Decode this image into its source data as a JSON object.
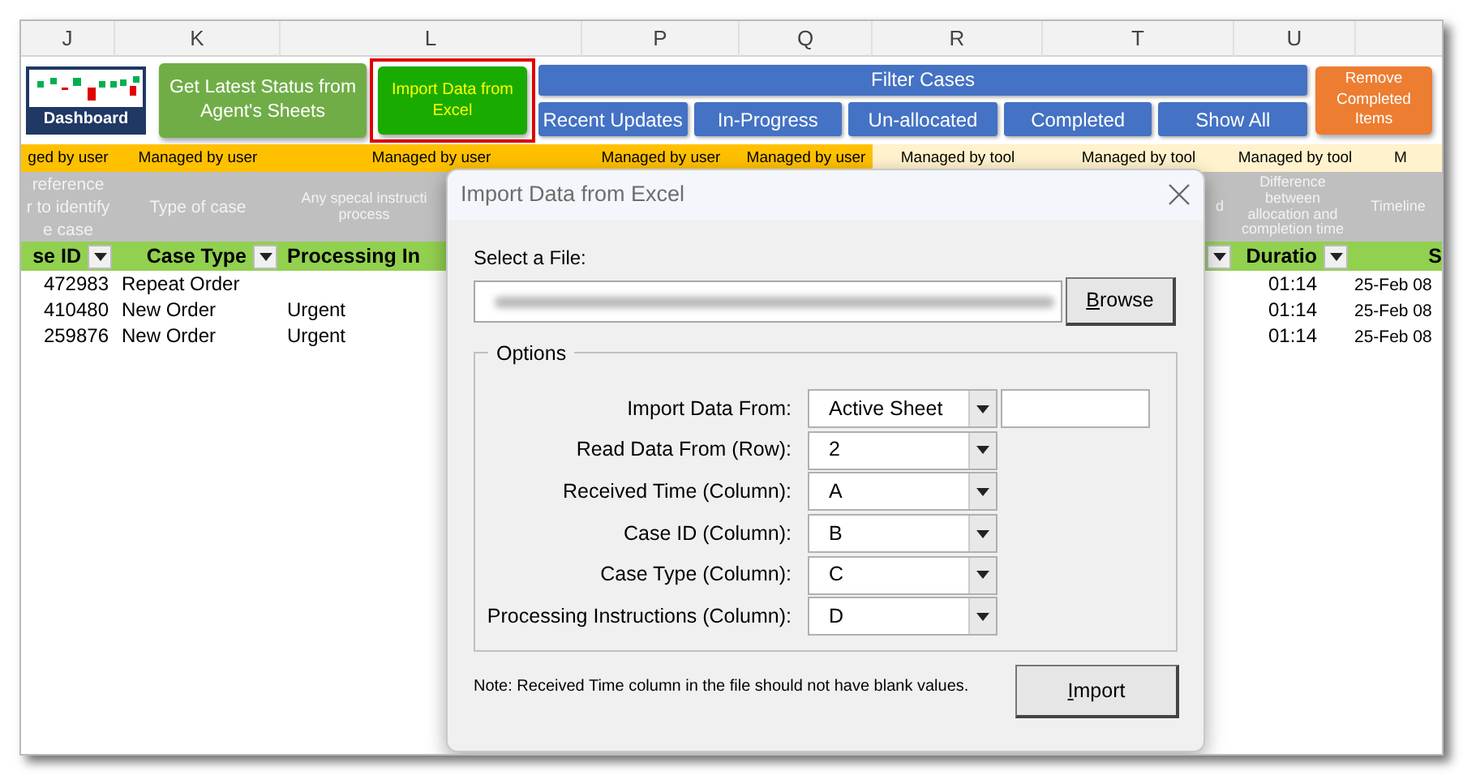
{
  "column_headers": [
    "J",
    "K",
    "L",
    "P",
    "Q",
    "R",
    "T",
    "U"
  ],
  "toolbar": {
    "dashboard_label": "Dashboard",
    "get_status": {
      "label": "Get Latest Status from Agent's Sheets",
      "selected": false
    },
    "import": {
      "label": "Import Data from Excel",
      "selected": true
    },
    "filter_title": "Filter Cases",
    "filters": [
      "Recent Updates",
      "In-Progress",
      "Un-allocated",
      "Completed",
      "Show All"
    ],
    "remove": "Remove Completed Items"
  },
  "ownership_row": [
    {
      "text": "ged by user",
      "kind": "user"
    },
    {
      "text": "Managed by user",
      "kind": "user"
    },
    {
      "text": "Managed by user",
      "kind": "user"
    },
    {
      "text": "Managed by user",
      "kind": "user"
    },
    {
      "text": "Managed by user",
      "kind": "user"
    },
    {
      "text": "Managed by tool",
      "kind": "tool"
    },
    {
      "text": "Managed by tool",
      "kind": "tool"
    },
    {
      "text": "Managed by tool",
      "kind": "tool"
    },
    {
      "text": "M",
      "kind": "tool"
    }
  ],
  "descriptions_left": [
    {
      "lines": [
        "reference",
        "r to identify",
        "e case"
      ]
    },
    {
      "lines": [
        "Type of case"
      ]
    },
    {
      "lines": [
        "Any specal instructi",
        "process"
      ]
    }
  ],
  "descriptions_right": [
    {
      "lines": [
        "d"
      ]
    },
    {
      "lines": [
        "Difference",
        "between",
        "allocation and",
        "completion time"
      ]
    },
    {
      "lines": [
        "Timeline"
      ]
    }
  ],
  "headers_left": [
    {
      "text": "se ID",
      "filter": true
    },
    {
      "text": "Case Type",
      "filter": true
    },
    {
      "text": "Processing In",
      "filter": false
    }
  ],
  "headers_right": [
    {
      "filter": true
    },
    {
      "text": "Duratio",
      "filter": true
    },
    {
      "text": "S",
      "filter": false
    }
  ],
  "rows": [
    {
      "case_id": "472983",
      "case_type": "Repeat Order",
      "duration": "01:14",
      "timeline": "25-Feb 08"
    },
    {
      "case_id": "410480",
      "case_type": "New Order",
      "instructions": "Urgent",
      "duration": "01:14",
      "timeline": "25-Feb 08"
    },
    {
      "case_id": "259876",
      "case_type": "New Order",
      "instructions": "Urgent",
      "duration": "01:14",
      "timeline": "25-Feb 08"
    }
  ],
  "dialog": {
    "title": "Import Data from Excel",
    "file_label": "Select a File:",
    "browse": {
      "label": "Browse",
      "mnemonic": true
    },
    "options_title": "Options",
    "options": [
      {
        "label": "Import Data From:",
        "value": "Active Sheet",
        "extra_field": true
      },
      {
        "label": "Read Data From (Row):",
        "value": "2"
      },
      {
        "label": "Received Time (Column):",
        "value": "A"
      },
      {
        "label": "Case ID (Column):",
        "value": "B"
      },
      {
        "label": "Case Type (Column):",
        "value": "C"
      },
      {
        "label": "Processing Instructions (Column):",
        "value": "D"
      }
    ],
    "note": "Note: Received Time column in the file should not have blank values.",
    "import": {
      "label": "Import",
      "mnemonic": true
    }
  }
}
